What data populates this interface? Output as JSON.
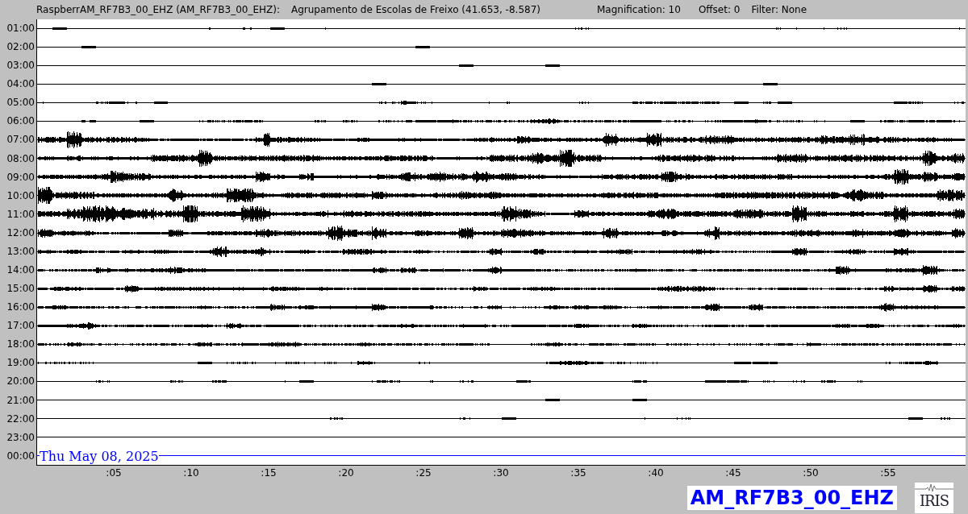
{
  "header": {
    "station": "RaspberrAM_RF7B3_00_EHZ (AM_RF7B3_00_EHZ):",
    "location": "Agrupamento de Escolas de Freixo (41.653, -8.587)",
    "magnification": "Magnification: 10",
    "offset": "Offset: 0",
    "filter": "Filter: None"
  },
  "rows": [
    {
      "label": "01:00",
      "color": "#000000"
    },
    {
      "label": "02:00",
      "color": "#000000"
    },
    {
      "label": "03:00",
      "color": "#000000"
    },
    {
      "label": "04:00",
      "color": "#000000"
    },
    {
      "label": "05:00",
      "color": "#000000"
    },
    {
      "label": "06:00",
      "color": "#000000"
    },
    {
      "label": "07:00",
      "color": "#000000"
    },
    {
      "label": "08:00",
      "color": "#000000"
    },
    {
      "label": "09:00",
      "color": "#000000"
    },
    {
      "label": "10:00",
      "color": "#000000"
    },
    {
      "label": "11:00",
      "color": "#000000"
    },
    {
      "label": "12:00",
      "color": "#000000"
    },
    {
      "label": "13:00",
      "color": "#000000"
    },
    {
      "label": "14:00",
      "color": "#000000"
    },
    {
      "label": "15:00",
      "color": "#000000"
    },
    {
      "label": "16:00",
      "color": "#000000"
    },
    {
      "label": "17:00",
      "color": "#000000"
    },
    {
      "label": "18:00",
      "color": "#000000"
    },
    {
      "label": "19:00",
      "color": "#000000"
    },
    {
      "label": "20:00",
      "color": "#000000"
    },
    {
      "label": "21:00",
      "color": "#000000"
    },
    {
      "label": "22:00",
      "color": "#000000"
    },
    {
      "label": "23:00",
      "color": "#000000"
    },
    {
      "label": "00:00",
      "color": "#0000ff"
    }
  ],
  "date": "Thu May 08, 2025",
  "x_ticks": [
    ":05",
    ":10",
    ":15",
    ":20",
    ":25",
    ":30",
    ":35",
    ":40",
    ":45",
    ":50",
    ":55"
  ],
  "channel_label": "AM_RF7B3_00_EHZ",
  "logo_text": "IRIS"
}
